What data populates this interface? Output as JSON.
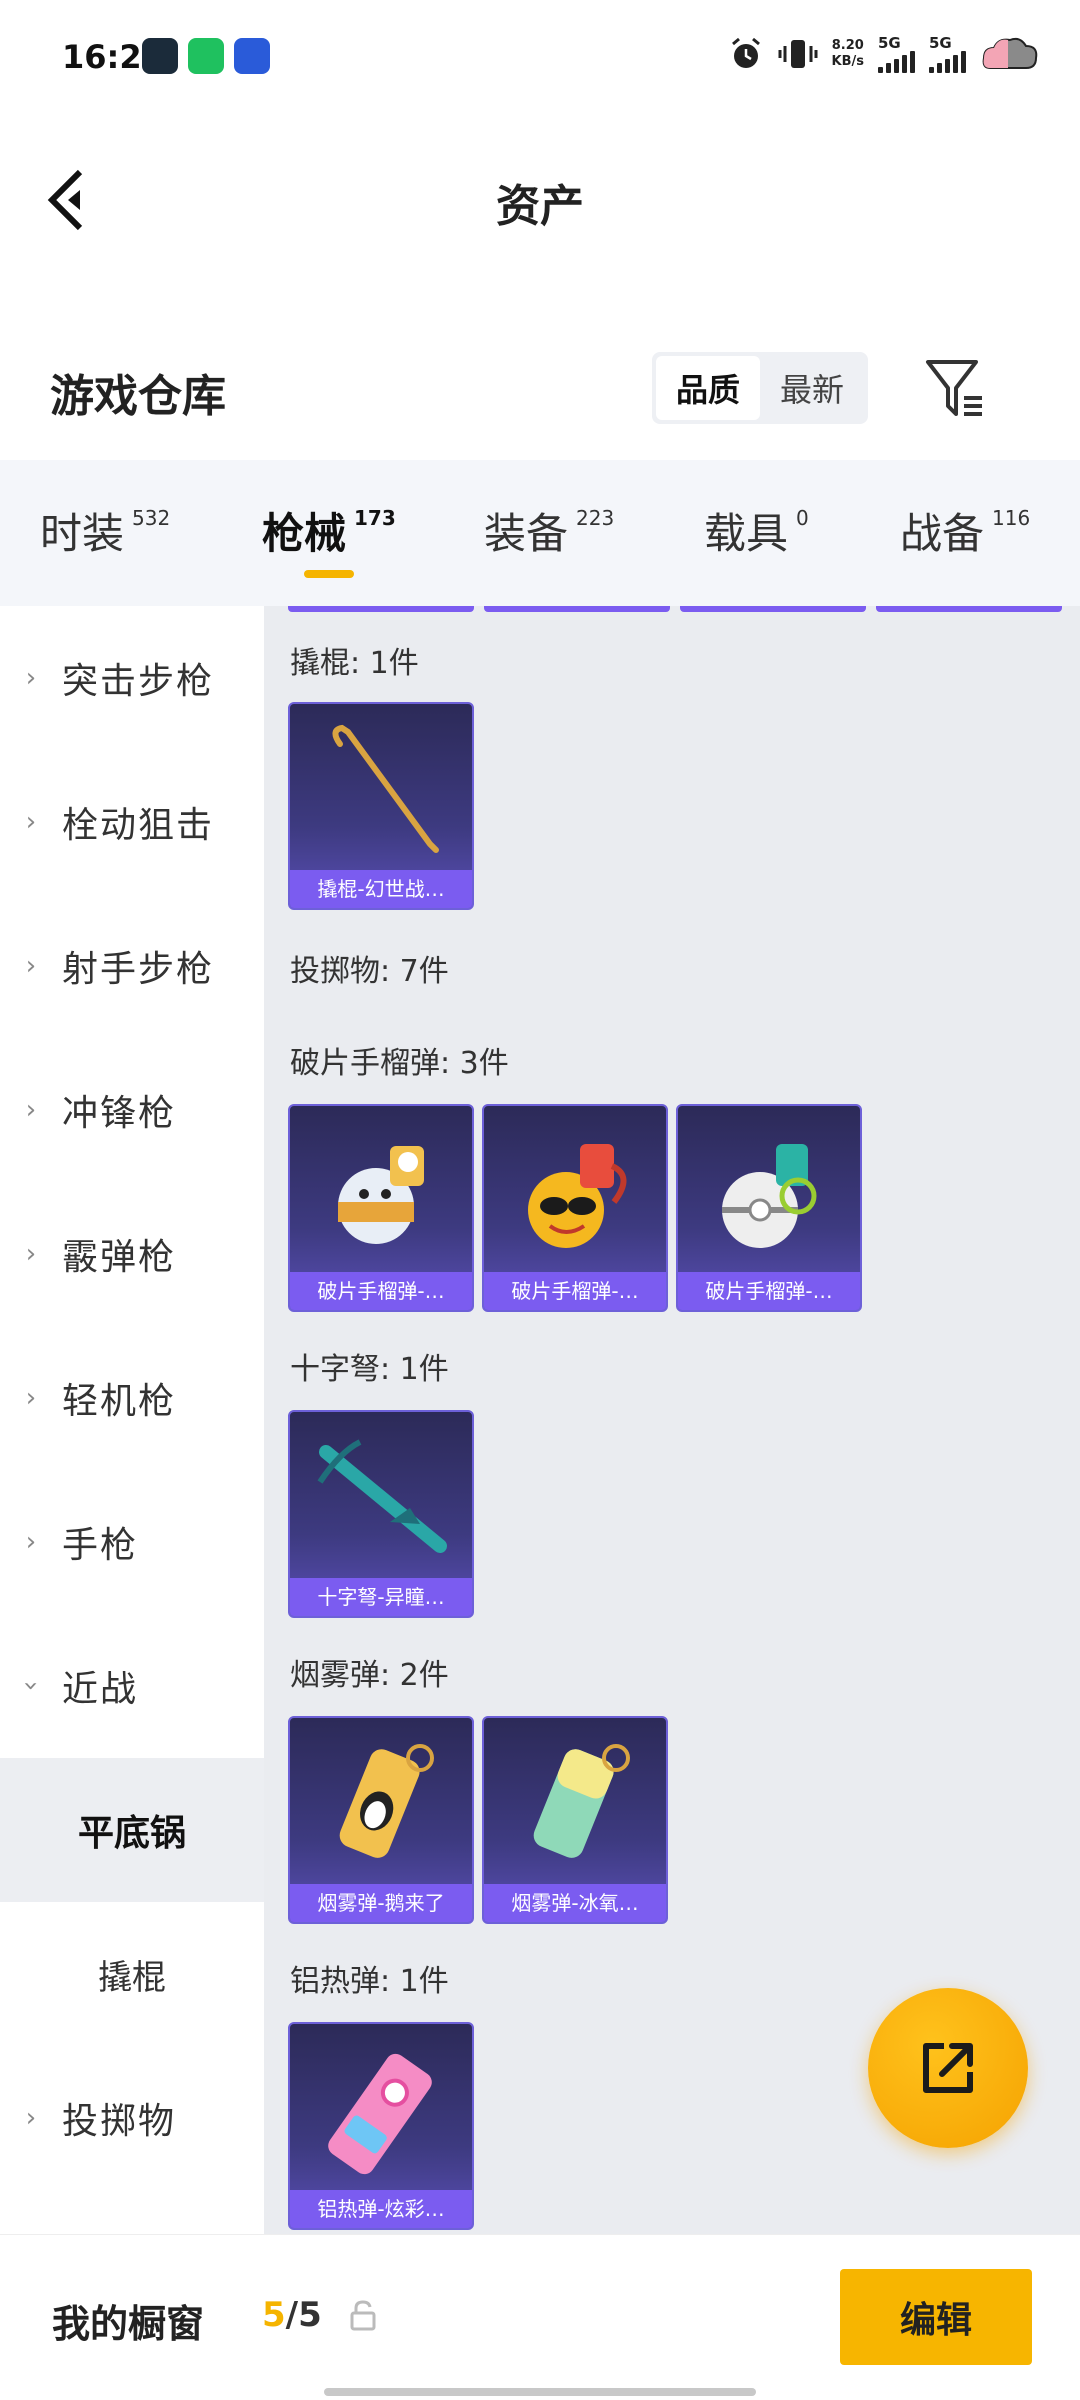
{
  "status_bar": {
    "time": "16:27",
    "speed_value": "8.20",
    "speed_unit": "KB/s",
    "sim1": "5G",
    "sim2": "5G"
  },
  "header": {
    "title": "资产"
  },
  "warehouse": {
    "title": "游戏仓库",
    "sort_options": [
      "品质",
      "最新"
    ],
    "active_sort": "品质"
  },
  "tabs": [
    {
      "label": "时装",
      "count": "532"
    },
    {
      "label": "枪械",
      "count": "173"
    },
    {
      "label": "装备",
      "count": "223"
    },
    {
      "label": "载具",
      "count": "0"
    },
    {
      "label": "战备",
      "count": "116"
    }
  ],
  "active_tab": "枪械",
  "side_nav": {
    "items": [
      {
        "label": "突击步枪",
        "expanded": false
      },
      {
        "label": "栓动狙击",
        "expanded": false
      },
      {
        "label": "射手步枪",
        "expanded": false
      },
      {
        "label": "冲锋枪",
        "expanded": false
      },
      {
        "label": "霰弹枪",
        "expanded": false
      },
      {
        "label": "轻机枪",
        "expanded": false
      },
      {
        "label": "手枪",
        "expanded": false
      },
      {
        "label": "近战",
        "expanded": true
      },
      {
        "label": "投掷物",
        "expanded": false
      }
    ],
    "sub_items": [
      {
        "label": "平底锅",
        "active": true
      },
      {
        "label": "撬棍",
        "active": false
      }
    ]
  },
  "content": {
    "groups": [
      {
        "label": "撬棍: 1件",
        "items": [
          "撬棍-幻世战…"
        ]
      },
      {
        "label": "投掷物: 7件",
        "items": []
      },
      {
        "label": "破片手榴弹: 3件",
        "items": [
          "破片手榴弹-…",
          "破片手榴弹-…",
          "破片手榴弹-…"
        ]
      },
      {
        "label": "十字弩: 1件",
        "items": [
          "十字弩-异瞳…"
        ]
      },
      {
        "label": "烟雾弹: 2件",
        "items": [
          "烟雾弹-鹅来了",
          "烟雾弹-冰氧…"
        ]
      },
      {
        "label": "铝热弹: 1件",
        "items": [
          "铝热弹-炫彩…"
        ]
      }
    ]
  },
  "bottom_bar": {
    "showcase_label": "我的橱窗",
    "showcase_current": "5",
    "showcase_total": "/5",
    "edit_label": "编辑"
  },
  "colors": {
    "accent": "#f5b400",
    "card_bg": "#3d3a80",
    "card_label": "#7b5cf0"
  }
}
